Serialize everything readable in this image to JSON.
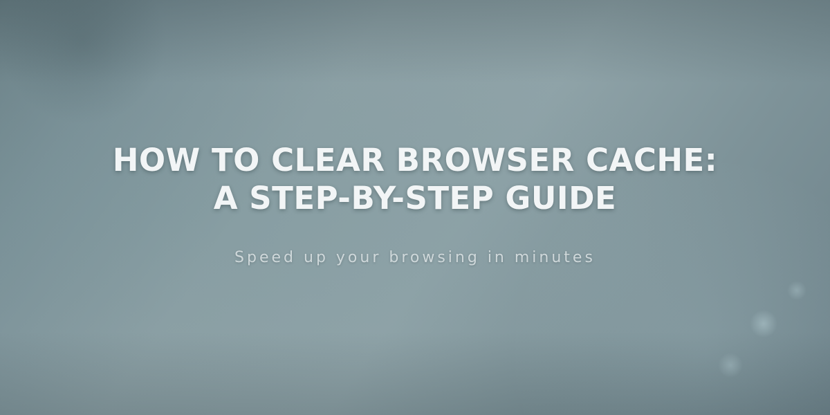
{
  "hero": {
    "title": "HOW TO CLEAR BROWSER CACHE: A STEP-BY-STEP GUIDE",
    "subtitle": "Speed up your browsing in minutes"
  }
}
